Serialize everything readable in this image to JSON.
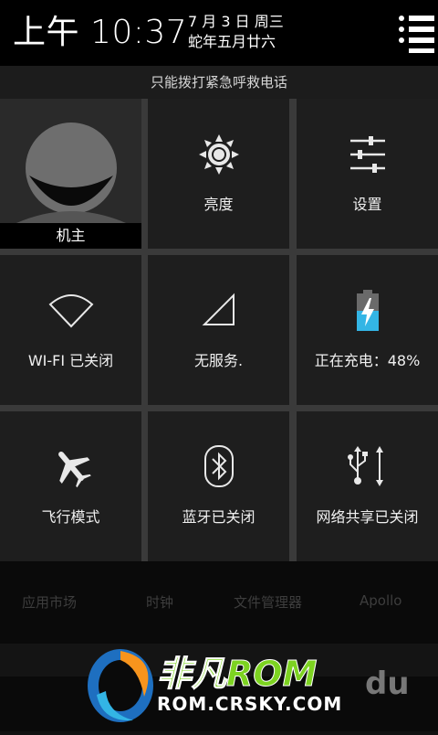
{
  "status": {
    "time": "上午 10:37",
    "date_line1": "7 月 3 日 周三",
    "date_line2": "蛇年五月廿六"
  },
  "emergency_text": "只能拨打紧急呼救电话",
  "tiles": {
    "owner": "机主",
    "brightness": "亮度",
    "settings": "设置",
    "wifi": "WI-FI 已关闭",
    "signal": "无服务.",
    "battery": "正在充电：48%",
    "airplane": "飞行模式",
    "bluetooth": "蓝牙已关闭",
    "tethering": "网络共享已关闭"
  },
  "battery_level": 0.48,
  "background_apps": [
    "应用市场",
    "时钟",
    "文件管理器",
    "Apollo"
  ],
  "watermark": {
    "brand": "非凡ROM",
    "url": "ROM.CRSKY.COM",
    "tag": "du"
  },
  "colors": {
    "accent_blue": "#33b5e5",
    "watermark_green": "#7dd321",
    "watermark_orange": "#f7941d"
  }
}
